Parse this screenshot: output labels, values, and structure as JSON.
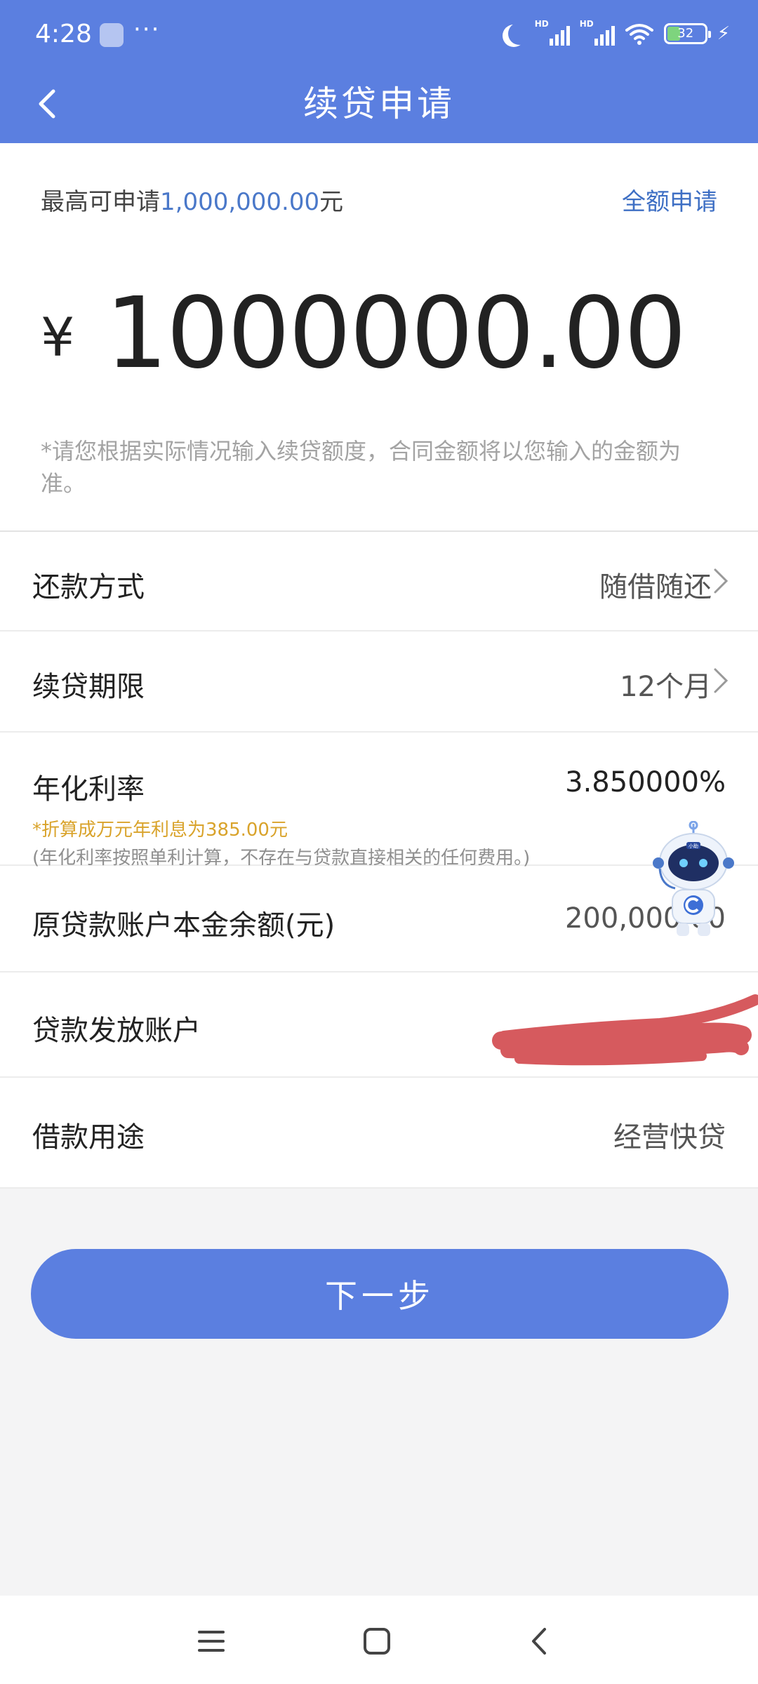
{
  "status_bar": {
    "time": "4:28",
    "dots": "···",
    "battery": "32",
    "network": [
      "HD",
      "HD"
    ]
  },
  "header": {
    "title": "续贷申请"
  },
  "amount": {
    "max_prefix": "最高可申请",
    "max_value": "1,000,000.00",
    "max_suffix": "元",
    "apply_all": "全额申请",
    "currency_symbol": "¥",
    "value": "1000000.00",
    "note": "*请您根据实际情况输入续贷额度，合同金额将以您输入的金额为准。"
  },
  "rows": {
    "repayment": {
      "label": "还款方式",
      "value": "随借随还"
    },
    "term": {
      "label": "续贷期限",
      "value": "12个月"
    },
    "rate": {
      "label": "年化利率",
      "value": "3.850000%",
      "hint_interest": "*折算成万元年利息为385.00元",
      "hint_note": "(年化利率按照单利计算，不存在与贷款直接相关的任何费用。)"
    },
    "balance": {
      "label": "原贷款账户本金余额(元)",
      "value": "200,000.00"
    },
    "account": {
      "label": "贷款发放账户"
    },
    "purpose": {
      "label": "借款用途",
      "value": "经营快贷"
    }
  },
  "actions": {
    "next": "下一步"
  },
  "mascot": {
    "badge": "小助"
  },
  "colors": {
    "brand_blue": "#5b7fe0",
    "link_blue": "#3e6fc4",
    "hint_orange": "#d9a32b",
    "redaction_red": "#d65a5e"
  }
}
